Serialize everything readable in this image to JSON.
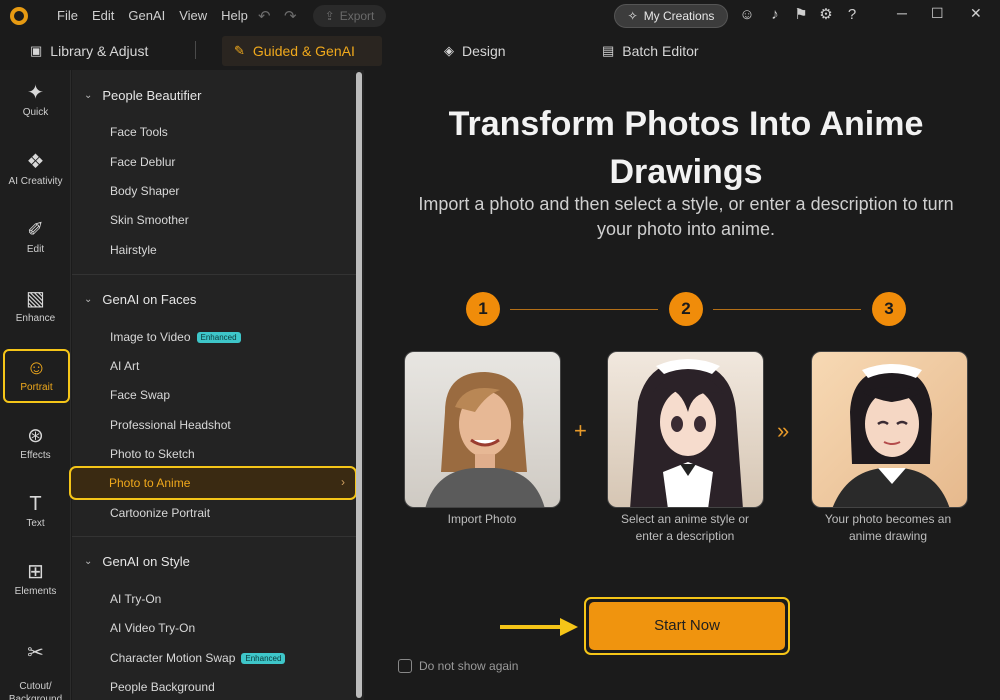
{
  "menubar": {
    "items": [
      "File",
      "Edit",
      "GenAI",
      "View",
      "Help"
    ],
    "export_label": "Export"
  },
  "toolbar": {
    "my_creations_label": "My Creations"
  },
  "mode_tabs": [
    {
      "label": "Library & Adjust"
    },
    {
      "label": "Guided & GenAI"
    },
    {
      "label": "Design"
    },
    {
      "label": "Batch Editor"
    }
  ],
  "rail": [
    {
      "label": "Quick"
    },
    {
      "label": "AI Creativity"
    },
    {
      "label": "Edit"
    },
    {
      "label": "Enhance"
    },
    {
      "label": "Portrait"
    },
    {
      "label": "Effects"
    },
    {
      "label": "Text"
    },
    {
      "label": "Elements"
    },
    {
      "label": "Cutout/\nBackground"
    }
  ],
  "submenu": {
    "people_beautifier": {
      "title": "People Beautifier",
      "items": [
        "Face Tools",
        "Face Deblur",
        "Body Shaper",
        "Skin Smoother",
        "Hairstyle"
      ]
    },
    "genai_faces": {
      "title": "GenAI on Faces",
      "items": [
        "Image to Video",
        "AI Art",
        "Face Swap",
        "Professional Headshot",
        "Photo to Sketch",
        "Photo to Anime",
        "Cartoonize Portrait"
      ],
      "badge": "Enhanced"
    },
    "genai_style": {
      "title": "GenAI on Style",
      "items": [
        "AI Try-On",
        "AI Video Try-On",
        "Character Motion Swap",
        "People Background"
      ],
      "badge": "Enhanced"
    }
  },
  "main": {
    "title_line1": "Transform Photos Into Anime",
    "title_line2": "Drawings",
    "subtitle_line1": "Import a photo and then select a style, or enter a description to turn",
    "subtitle_line2": "your photo into anime.",
    "steps": [
      {
        "num": "1",
        "cap1": "Import Photo",
        "cap2": ""
      },
      {
        "num": "2",
        "cap1": "Select an anime style or",
        "cap2": "enter a description"
      },
      {
        "num": "3",
        "cap1": "Your photo becomes an",
        "cap2": "anime drawing"
      }
    ],
    "start_label": "Start Now",
    "dont_show_label": "Do not show again"
  },
  "colors": {
    "accent": "#f0940e",
    "highlight": "#f5c518",
    "bg": "#1b1b1b"
  }
}
